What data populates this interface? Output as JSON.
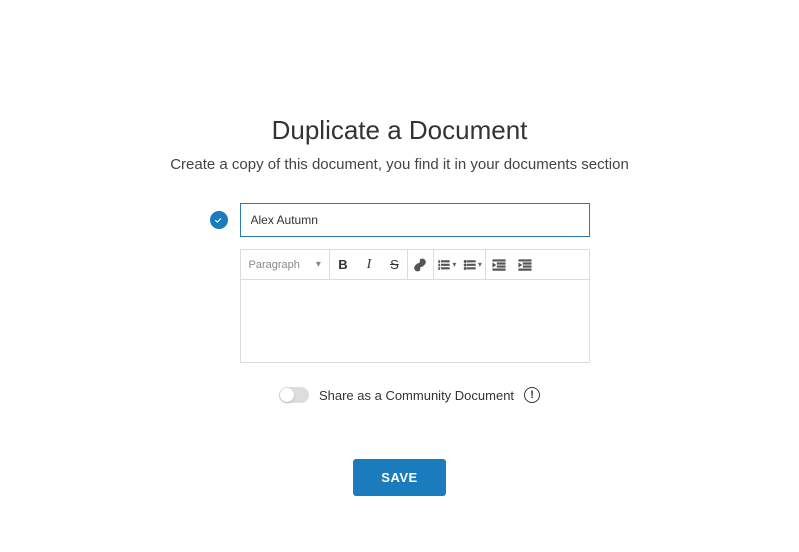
{
  "page": {
    "title": "Duplicate a Document",
    "subtitle": "Create a copy of this document, you find it in your documents section"
  },
  "form": {
    "title_value": "Alex Autumn",
    "format_label": "Paragraph",
    "share_label": "Share as a Community Document",
    "share_enabled": false,
    "save_label": "SAVE"
  },
  "toolbar": {
    "buttons": [
      "bold",
      "italic",
      "strikethrough",
      "link",
      "numbered-list",
      "bullet-list",
      "outdent",
      "indent"
    ]
  }
}
